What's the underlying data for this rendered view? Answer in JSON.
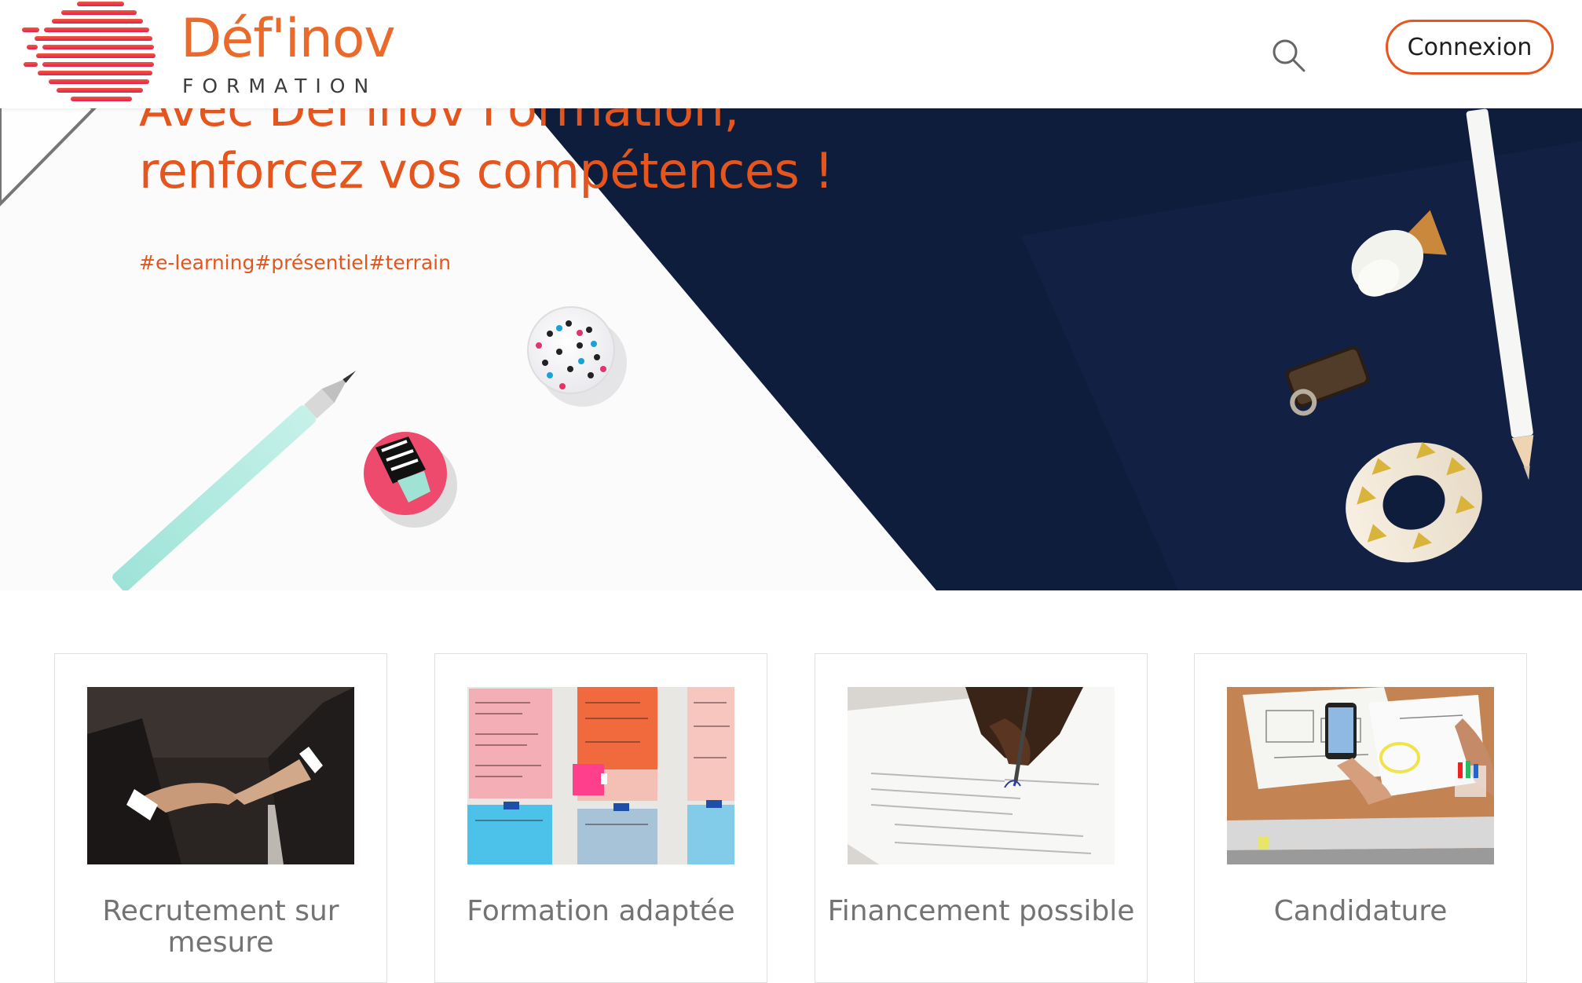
{
  "header": {
    "logo_name": "Déf'inov",
    "logo_sub": "FORMATION",
    "login_label": "Connexion"
  },
  "hero": {
    "line1": "Avec Déf'inov Formation,",
    "line2": "renforcez vos compétences !",
    "tags": "#e-learning#présentiel#terrain"
  },
  "cards": [
    {
      "title": "Recrutement sur mesure",
      "image": "handshake"
    },
    {
      "title": "Formation adaptée",
      "image": "sticky-notes-wall"
    },
    {
      "title": "Financement possible",
      "image": "signing-document"
    },
    {
      "title": "Candidature",
      "image": "desk-phone-sketches"
    }
  ],
  "icons": [
    "logo-mark-icon",
    "search-icon"
  ],
  "colors": {
    "brand_orange": "#e8561e",
    "hero_navy": "#0f1d3c",
    "card_title": "#737373"
  }
}
